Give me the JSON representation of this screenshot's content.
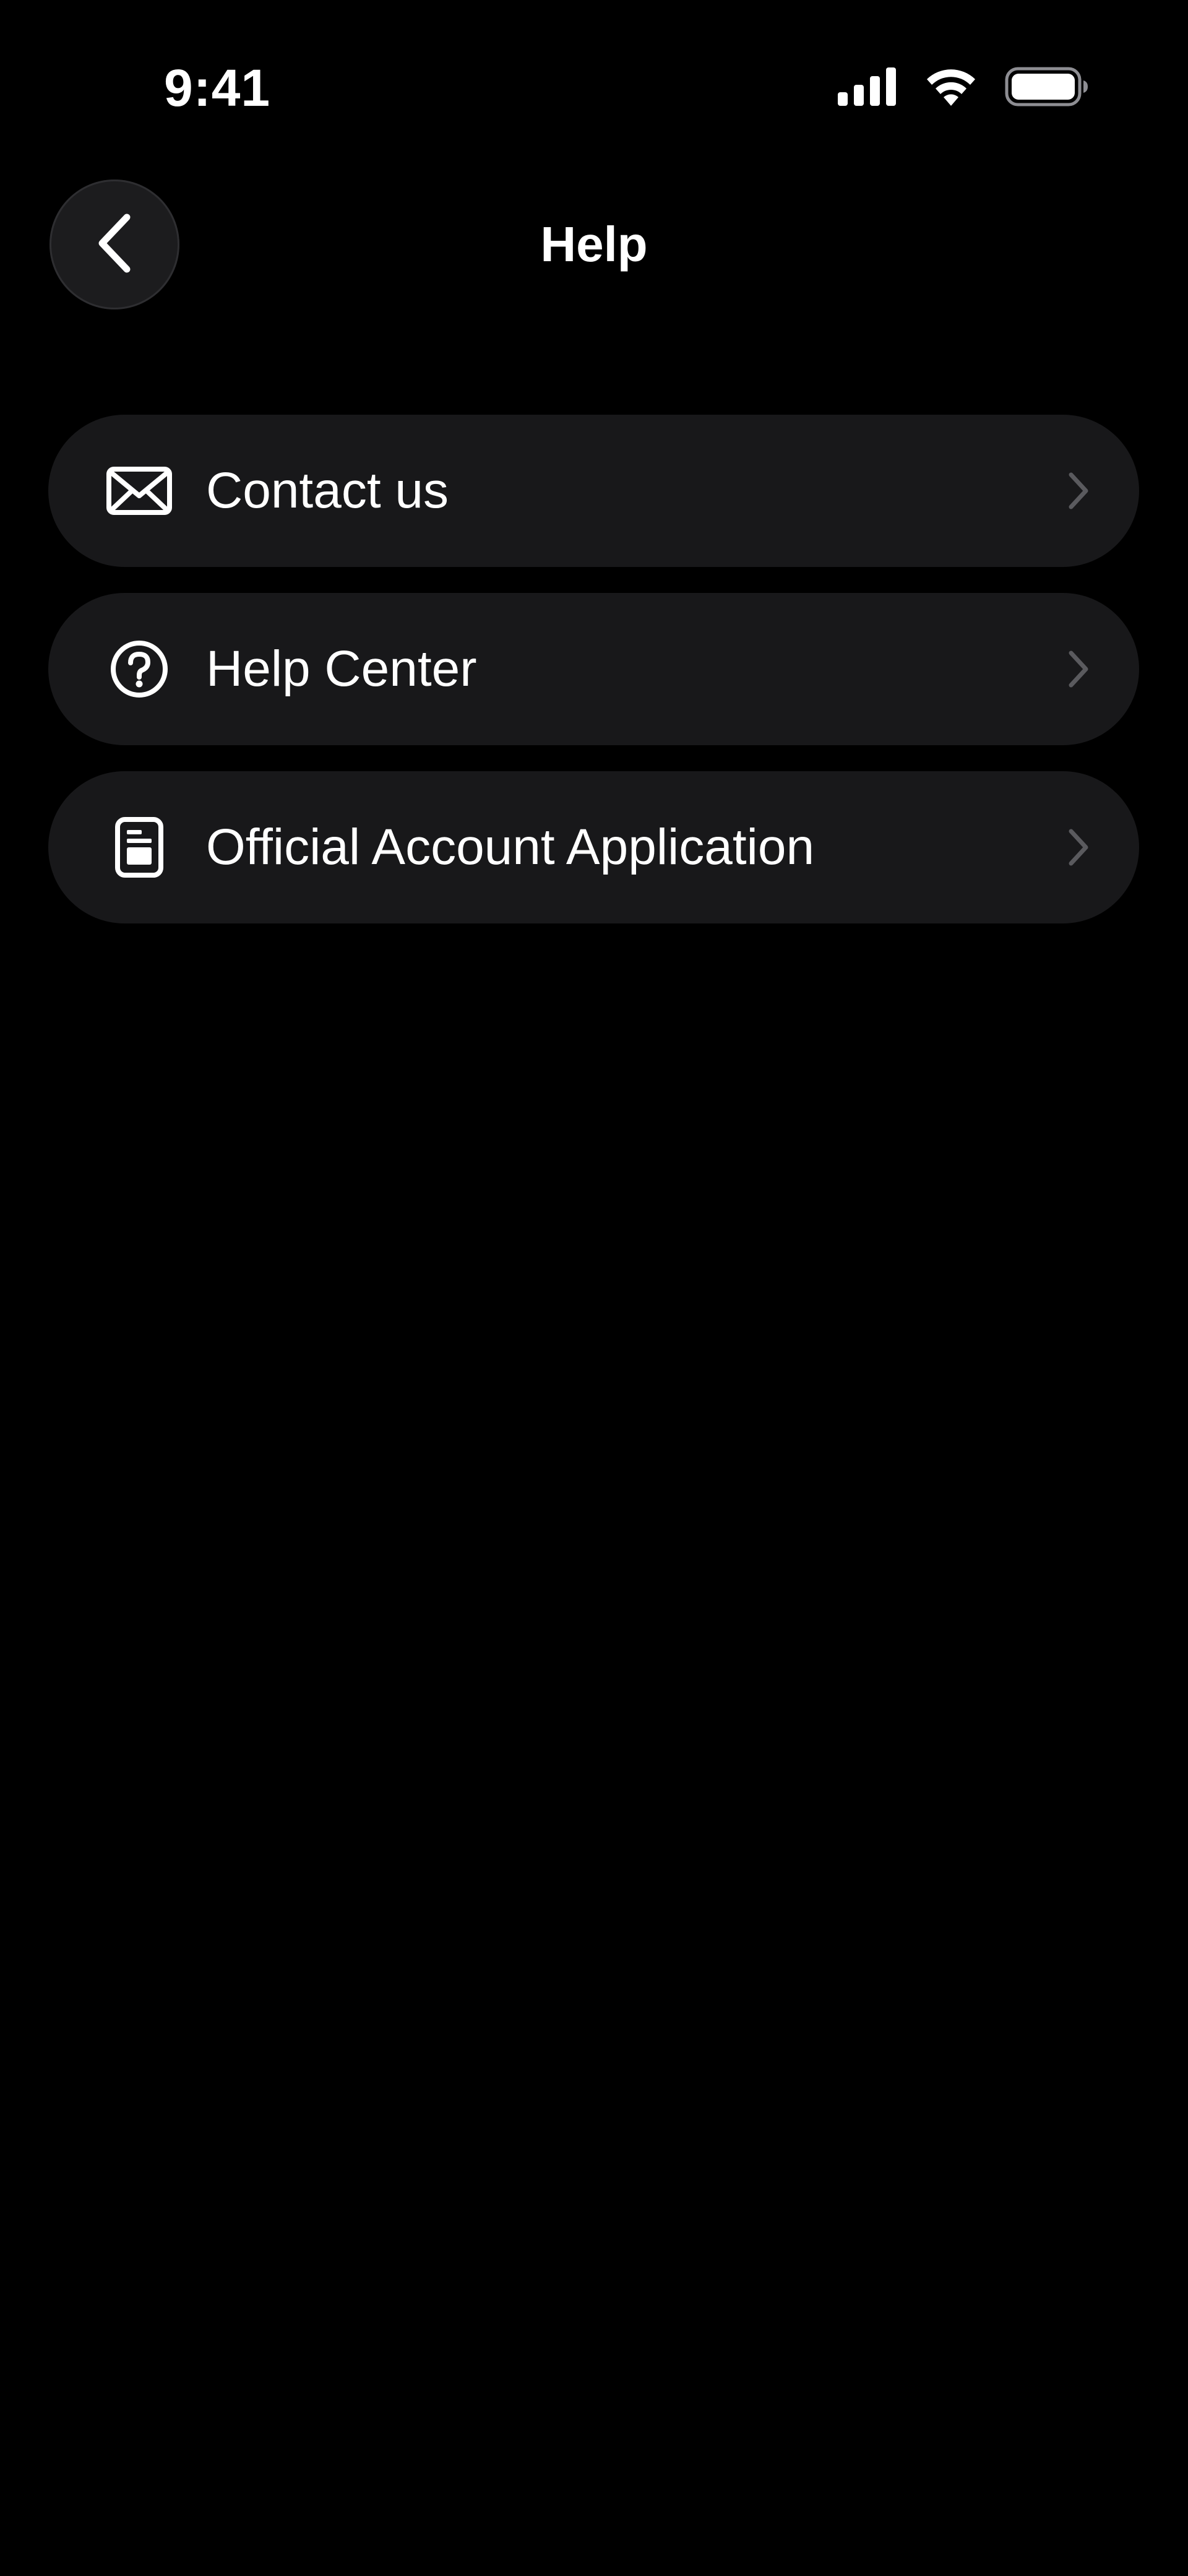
{
  "status_bar": {
    "time": "9:41",
    "icons": [
      "cellular-signal-icon",
      "wifi-icon",
      "battery-icon"
    ]
  },
  "nav": {
    "title": "Help",
    "back_icon": "chevron-left-icon"
  },
  "menu": {
    "items": [
      {
        "label": "Contact us",
        "icon": "envelope-icon"
      },
      {
        "label": "Help Center",
        "icon": "question-circle-icon"
      },
      {
        "label": "Official Account Application",
        "icon": "document-icon"
      }
    ]
  },
  "colors": {
    "background": "#000000",
    "row_background": "#18181a",
    "back_button_background": "#1c1c1e",
    "text": "#ffffff",
    "chevron": "#5a5a5e"
  }
}
